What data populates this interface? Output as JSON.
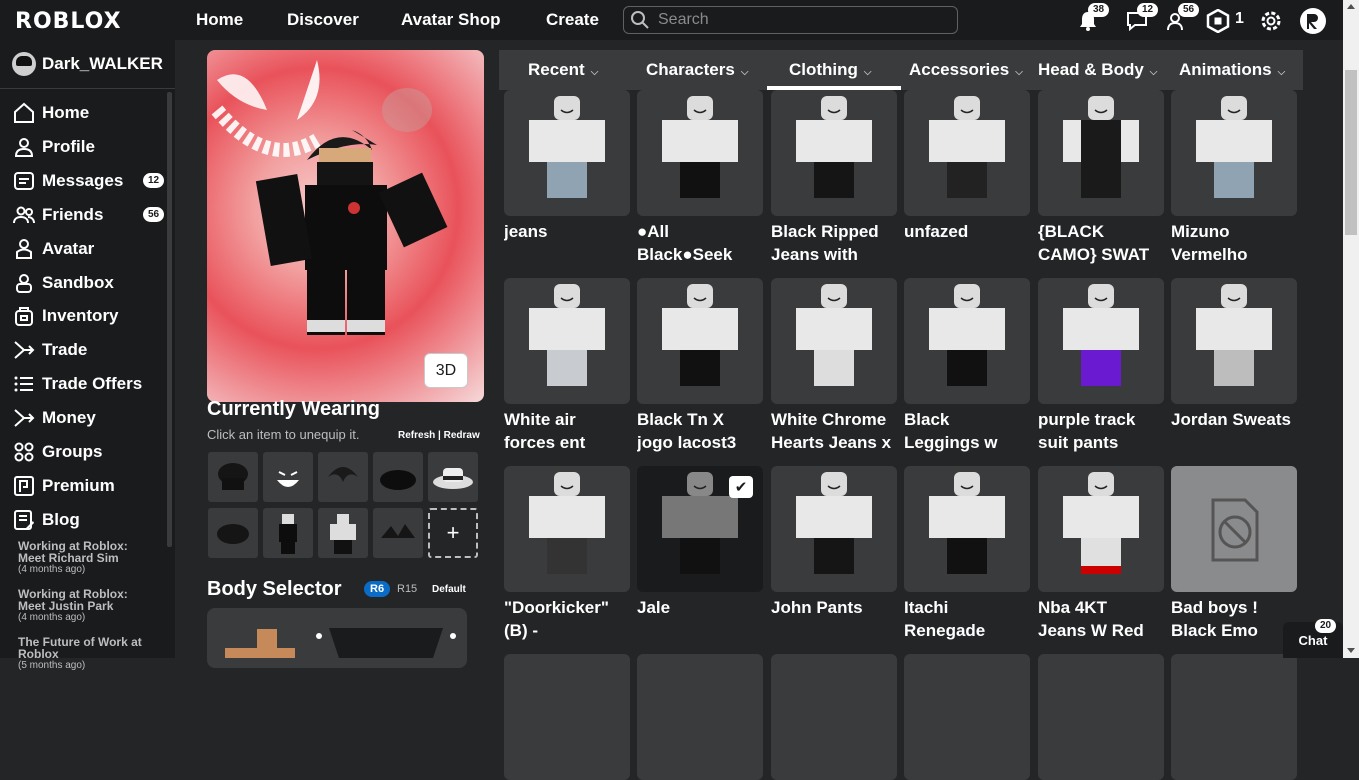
{
  "topbar": {
    "logo": "ROBLOX",
    "nav": [
      "Home",
      "Discover",
      "Avatar Shop",
      "Create"
    ],
    "search_placeholder": "Search",
    "notifications_count": "38",
    "messages_count": "12",
    "friends_count": "56",
    "robux": "1"
  },
  "sidebar": {
    "username": "Dark_WALKER",
    "items": [
      {
        "label": "Home",
        "icon": "home-icon"
      },
      {
        "label": "Profile",
        "icon": "profile-icon"
      },
      {
        "label": "Messages",
        "icon": "messages-icon",
        "count": "12"
      },
      {
        "label": "Friends",
        "icon": "friends-icon",
        "count": "56"
      },
      {
        "label": "Avatar",
        "icon": "avatar-icon"
      },
      {
        "label": "Sandbox",
        "icon": "sandbox-icon"
      },
      {
        "label": "Inventory",
        "icon": "inventory-icon"
      },
      {
        "label": "Trade",
        "icon": "trade-icon"
      },
      {
        "label": "Trade Offers",
        "icon": "trade-offers-icon"
      },
      {
        "label": "Money",
        "icon": "money-icon"
      },
      {
        "label": "Groups",
        "icon": "groups-icon"
      },
      {
        "label": "Premium",
        "icon": "premium-icon"
      },
      {
        "label": "Blog",
        "icon": "blog-icon"
      }
    ],
    "blog_posts": [
      {
        "title1": "Working at Roblox:",
        "title2": "Meet Richard Sim",
        "age": "(4 months ago)"
      },
      {
        "title1": "Working at Roblox:",
        "title2": "Meet Justin Park",
        "age": "(4 months ago)"
      },
      {
        "title1": "The Future of Work at",
        "title2": "Roblox",
        "age": "(5 months ago)"
      }
    ]
  },
  "avatar": {
    "view_toggle": "3D",
    "currently_wearing_title": "Currently Wearing",
    "currently_wearing_sub": "Click an item to unequip it.",
    "refresh": "Refresh",
    "separator": "|",
    "redraw": "Redraw",
    "add_symbol": "+",
    "body_selector_title": "Body Selector",
    "r6": "R6",
    "r15": "R15",
    "default": "Default"
  },
  "tabs": [
    {
      "label": "Recent"
    },
    {
      "label": "Characters"
    },
    {
      "label": "Clothing"
    },
    {
      "label": "Accessories"
    },
    {
      "label": "Head & Body"
    },
    {
      "label": "Animations"
    }
  ],
  "active_tab": "Clothing",
  "items": [
    {
      "l1": "jeans",
      "l2": ""
    },
    {
      "l1": "●All",
      "l2": "Black●Seek"
    },
    {
      "l1": "Black Ripped",
      "l2": "Jeans with"
    },
    {
      "l1": "unfazed",
      "l2": ""
    },
    {
      "l1": "{BLACK",
      "l2": "CAMO} SWAT"
    },
    {
      "l1": "Mizuno",
      "l2": "Vermelho"
    },
    {
      "l1": "White air",
      "l2": "forces ent"
    },
    {
      "l1": "Black Tn X",
      "l2": "jogo lacost3"
    },
    {
      "l1": "White Chrome",
      "l2": "Hearts Jeans x"
    },
    {
      "l1": "Black",
      "l2": "Leggings w"
    },
    {
      "l1": "purple track",
      "l2": "suit pants"
    },
    {
      "l1": "Jordan Sweats",
      "l2": ""
    },
    {
      "l1": "\"Doorkicker\"",
      "l2": "(B) -"
    },
    {
      "l1": "Jale",
      "l2": ""
    },
    {
      "l1": "John Pants",
      "l2": ""
    },
    {
      "l1": "Itachi",
      "l2": "Renegade"
    },
    {
      "l1": "Nba 4KT",
      "l2": "Jeans W Red"
    },
    {
      "l1": "Bad boys !",
      "l2": "Black Emo"
    }
  ],
  "chat": {
    "label": "Chat",
    "count": "20"
  }
}
